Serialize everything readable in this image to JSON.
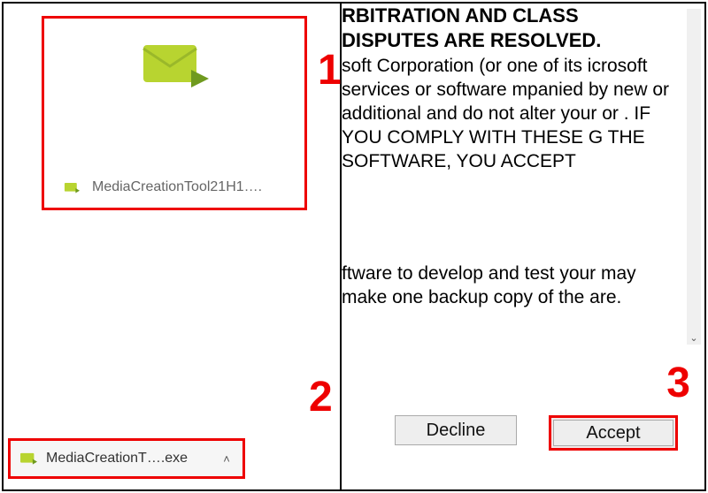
{
  "annotations": {
    "marker1": "1",
    "marker2": "2",
    "marker3": "3"
  },
  "tile": {
    "filename": "MediaCreationTool21H1…."
  },
  "download_bar": {
    "filename": "MediaCreationT….exe",
    "chevron": "˄"
  },
  "license": {
    "heading_frag": "RBITRATION AND CLASS DISPUTES ARE RESOLVED.",
    "para1_frag": "soft Corporation (or one of its icrosoft services or software mpanied by new or additional and do not alter your or . IF YOU COMPLY WITH THESE G THE SOFTWARE, YOU ACCEPT",
    "para2_frag": "ftware to develop and test your may make one backup copy of the are."
  },
  "buttons": {
    "decline": "Decline",
    "accept": "Accept"
  },
  "scrollbar": {
    "down": "⌄"
  },
  "icon_colors": {
    "body": "#b8d430",
    "flap": "#9ab82a",
    "arrow": "#6f9a1f"
  }
}
